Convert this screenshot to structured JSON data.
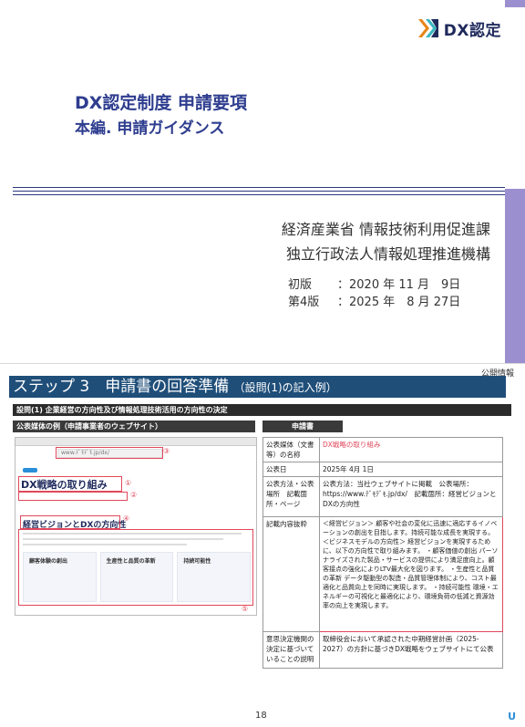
{
  "cover": {
    "logo_text": "DX認定",
    "title_line1": "DX認定制度 申請要項",
    "title_line2": "本編. 申請ガイダンス",
    "org_line1": "経済産業省 情報技術利用促進課",
    "org_line2": "独立行政法人情報処理推進機構",
    "version1_label": "初版",
    "version1_date": "：2020 年 11 月　9日",
    "version2_label": "第4版",
    "version2_date": "：2025 年　8 月 27日",
    "colors": {
      "navy": "#2e3d8f",
      "accent_orange": "#e8861a",
      "accent_teal": "#3ab7c2",
      "tab_purple": "#9b8fcf"
    }
  },
  "slide": {
    "confidential": "公開情報",
    "title_main": "ステップ 3　申請書の回答準備",
    "title_sub": "（設問(1)の記入例）",
    "question_bar": "設問(1) 企業経営の方向性及び情報処理技術活用の方向性の決定",
    "left_header": "公表媒体の例（申請事業者のウェブサイト）",
    "right_header": "申請書",
    "browser": {
      "address": "www.ﾃﾞﾓﾃﾞﾓ.jp/dx/",
      "heading": "DX戦略の取り組み",
      "section_title": "経営ビジョンとDXの方向性",
      "cards": [
        "顧客体験の創出",
        "生産性と品質の革新",
        "持続可能性"
      ]
    },
    "markers": [
      "①",
      "②",
      "③",
      "④",
      "⑤"
    ],
    "form": {
      "rows": [
        {
          "label": "公表媒体（文書等）の名称",
          "value": "DX戦略の取り組み"
        },
        {
          "label": "公表日",
          "value": "2025年 4月 1日"
        },
        {
          "label": "公表方法・公表場所　記載箇所・ページ",
          "value": "公表方法：当社ウェブサイトに掲載　公表場所：https://www.ﾃﾞﾓﾃﾞﾓ.jp/dx/　記載箇所：経営ビジョンとDXの方向性"
        },
        {
          "label": "記載内容抜粋",
          "value": "＜経営ビジョン＞ 顧客や社会の変化に迅速に適応するイノベーションの創出を目指します。持続可能な成長を実現する。 ＜ビジネスモデルの方向性＞ 経営ビジョンを実現するために、以下の方向性で取り組みます。 ・顧客価値の創出 パーソナライズされた製品・サービスの提供により満足度向上。顧客接点の強化によりLTV最大化を図ります。 ・生産性と品質の革新 データ駆動型の製造・品質管理体制により、コスト最適化と品質向上を同時に実現します。 ・持続可能性 環境・エネルギーの可視化と最適化により、環境負荷の低減と資源効率の向上を実現します。"
        },
        {
          "label": "意思決定機関の決定に基づいていることの説明",
          "value": "取締役会において承認された中期経営計画（2025-2027）の方針に基づきDX戦略をウェブサイトにて公表"
        }
      ]
    },
    "page_number": "18",
    "corner_icon": "U"
  }
}
